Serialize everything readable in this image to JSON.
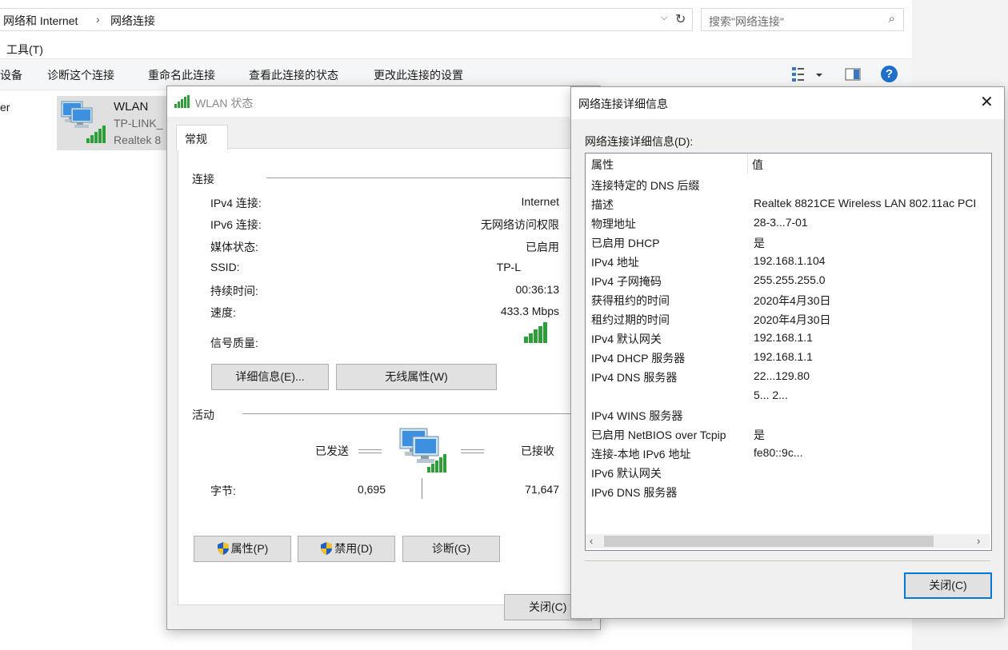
{
  "explorer": {
    "breadcrumb": [
      "网络和 Internet",
      "网络连接"
    ],
    "search_placeholder": "搜索\"网络连接\"",
    "menu": [
      "工具(T)"
    ],
    "commands": [
      "设备",
      "诊断这个连接",
      "重命名此连接",
      "查看此连接的状态",
      "更改此连接的设置"
    ],
    "left_partial_text": "er",
    "connection": {
      "name": "WLAN",
      "network": "TP-LINK_",
      "adapter": "Realtek 8"
    }
  },
  "wlan_status": {
    "title": "WLAN 状态",
    "tab": "常规",
    "section_connection": "连接",
    "rows": [
      {
        "label": "IPv4 连接:",
        "value": "Internet"
      },
      {
        "label": "IPv6 连接:",
        "value": "无网络访问权限"
      },
      {
        "label": "媒体状态:",
        "value": "已启用"
      },
      {
        "label": "SSID:",
        "value": "TP-L"
      },
      {
        "label": "持续时间:",
        "value": "00:36:13"
      },
      {
        "label": "速度:",
        "value": "433.3 Mbps"
      }
    ],
    "signal_label": "信号质量:",
    "signal_bars": 5,
    "details_button": "详细信息(E)...",
    "wireless_props_button": "无线属性(W)",
    "section_activity": "活动",
    "sent_label": "已发送",
    "received_label": "已接收",
    "bytes_label": "字节:",
    "bytes_sent": "0,695",
    "bytes_received": "71,647",
    "properties_button": "属性(P)",
    "disable_button": "禁用(D)",
    "diagnose_button": "诊断(G)",
    "close_button": "关闭(C)"
  },
  "details": {
    "title": "网络连接详细信息",
    "list_label": "网络连接详细信息(D):",
    "col_property": "属性",
    "col_value": "值",
    "rows": [
      {
        "name": "连接特定的 DNS 后缀",
        "value": ""
      },
      {
        "name": "描述",
        "value": "Realtek 8821CE Wireless LAN 802.11ac PCI"
      },
      {
        "name": "物理地址",
        "value": "28-3...7-01"
      },
      {
        "name": "已启用 DHCP",
        "value": "是"
      },
      {
        "name": "IPv4 地址",
        "value": "192.168.1.104"
      },
      {
        "name": "IPv4 子网掩码",
        "value": "255.255.255.0"
      },
      {
        "name": "获得租约的时间",
        "value": "2020年4月30日"
      },
      {
        "name": "租约过期的时间",
        "value": "2020年4月30日"
      },
      {
        "name": "IPv4 默认网关",
        "value": "192.168.1.1"
      },
      {
        "name": "IPv4 DHCP 服务器",
        "value": "192.168.1.1"
      },
      {
        "name": "IPv4 DNS 服务器",
        "value": "22...129.80"
      },
      {
        "name": "",
        "value": "5... 2..."
      },
      {
        "name": "IPv4 WINS 服务器",
        "value": ""
      },
      {
        "name": "已启用 NetBIOS over Tcpip",
        "value": "是"
      },
      {
        "name": "连接-本地 IPv6 地址",
        "value": "fe80::9c..."
      },
      {
        "name": "IPv6 默认网关",
        "value": ""
      },
      {
        "name": "IPv6 DNS 服务器",
        "value": ""
      }
    ],
    "close_button": "关闭(C)"
  }
}
